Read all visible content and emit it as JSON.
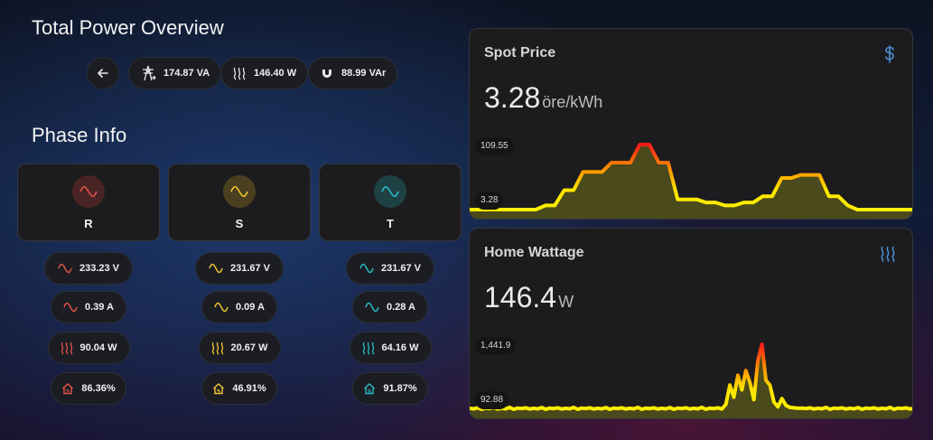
{
  "overview": {
    "title": "Total Power Overview",
    "chips": [
      {
        "icon": "transmission-tower-icon",
        "text": "174.87 VA"
      },
      {
        "icon": "heat-waves-icon",
        "text": "146.40 W"
      },
      {
        "icon": "magnet-icon",
        "text": "88.99 VAr"
      }
    ]
  },
  "phase_info": {
    "title": "Phase Info",
    "phases": [
      {
        "label": "R",
        "color": "#e2534b",
        "icon_bg": "#4a2424",
        "voltage": "233.23 V",
        "current": "0.39 A",
        "power": "90.04 W",
        "pf": "86.36%"
      },
      {
        "label": "S",
        "color": "#f2c531",
        "icon_bg": "#4a4020",
        "voltage": "231.67 V",
        "current": "0.09 A",
        "power": "20.67 W",
        "pf": "46.91%"
      },
      {
        "label": "T",
        "color": "#2bbbc8",
        "icon_bg": "#1e4244",
        "voltage": "231.67 V",
        "current": "0.28 A",
        "power": "64.16 W",
        "pf": "91.87%"
      }
    ]
  },
  "spot_price": {
    "title": "Spot Price",
    "icon": "dollar-icon",
    "value": "3.28",
    "unit": "öre/kWh",
    "max_label": "109.55",
    "min_label": "3.28",
    "series": [
      3.28,
      3.28,
      3.28,
      3.28,
      3.28,
      3.28,
      3.28,
      3.28,
      10,
      10,
      35,
      35,
      65,
      65,
      65,
      80,
      80,
      80,
      109.55,
      109.55,
      80,
      80,
      20,
      20,
      20,
      15,
      15,
      10,
      10,
      15,
      15,
      25,
      25,
      55,
      55,
      60,
      60,
      60,
      25,
      25,
      10,
      3.28,
      3.28,
      3.28,
      3.28,
      3.28,
      3.28,
      3.28
    ]
  },
  "home_wattage": {
    "title": "Home Wattage",
    "icon": "heat-waves-icon",
    "value": "146.4",
    "unit": "W",
    "max_label": "1,441.9",
    "min_label": "92.88",
    "series": [
      120,
      110,
      130,
      100,
      125,
      115,
      135,
      105,
      120,
      110,
      140,
      100,
      125,
      115,
      130,
      105,
      120,
      110,
      135,
      100,
      125,
      115,
      130,
      105,
      120,
      110,
      140,
      100,
      125,
      115,
      130,
      105,
      120,
      110,
      135,
      100,
      125,
      115,
      130,
      105,
      120,
      110,
      140,
      100,
      125,
      115,
      130,
      105,
      120,
      110,
      135,
      100,
      125,
      115,
      130,
      105,
      120,
      110,
      140,
      100,
      125,
      115,
      130,
      105,
      200,
      600,
      350,
      800,
      500,
      900,
      650,
      300,
      1100,
      1441.9,
      700,
      600,
      250,
      150,
      320,
      180,
      140,
      130,
      120,
      125,
      115,
      130,
      105,
      120,
      110,
      140,
      100,
      125,
      115,
      130,
      105,
      120,
      110,
      135,
      100,
      125,
      115,
      130,
      105,
      120,
      110,
      140,
      100,
      125,
      115,
      130,
      105,
      120
    ]
  }
}
